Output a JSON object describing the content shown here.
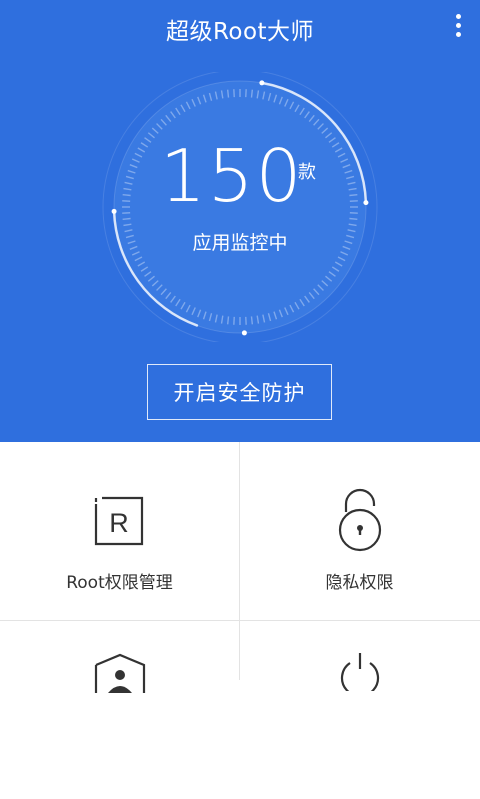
{
  "header": {
    "title": "超级Root大师",
    "menu_icon": "more-vertical-icon"
  },
  "monitor": {
    "count": "150",
    "unit": "款",
    "status": "应用监控中"
  },
  "protect_button": {
    "label": "开启安全防护"
  },
  "tiles": [
    {
      "label": "Root权限管理",
      "icon": "root-r-icon"
    },
    {
      "label": "隐私权限",
      "icon": "padlock-icon"
    },
    {
      "label": "",
      "icon": "shield-user-icon"
    },
    {
      "label": "",
      "icon": "power-icon"
    }
  ],
  "colors": {
    "header_bg": "#2f6fde",
    "text_light": "#ffffff",
    "text_dark": "#333333",
    "divider": "#e3e3e3"
  }
}
